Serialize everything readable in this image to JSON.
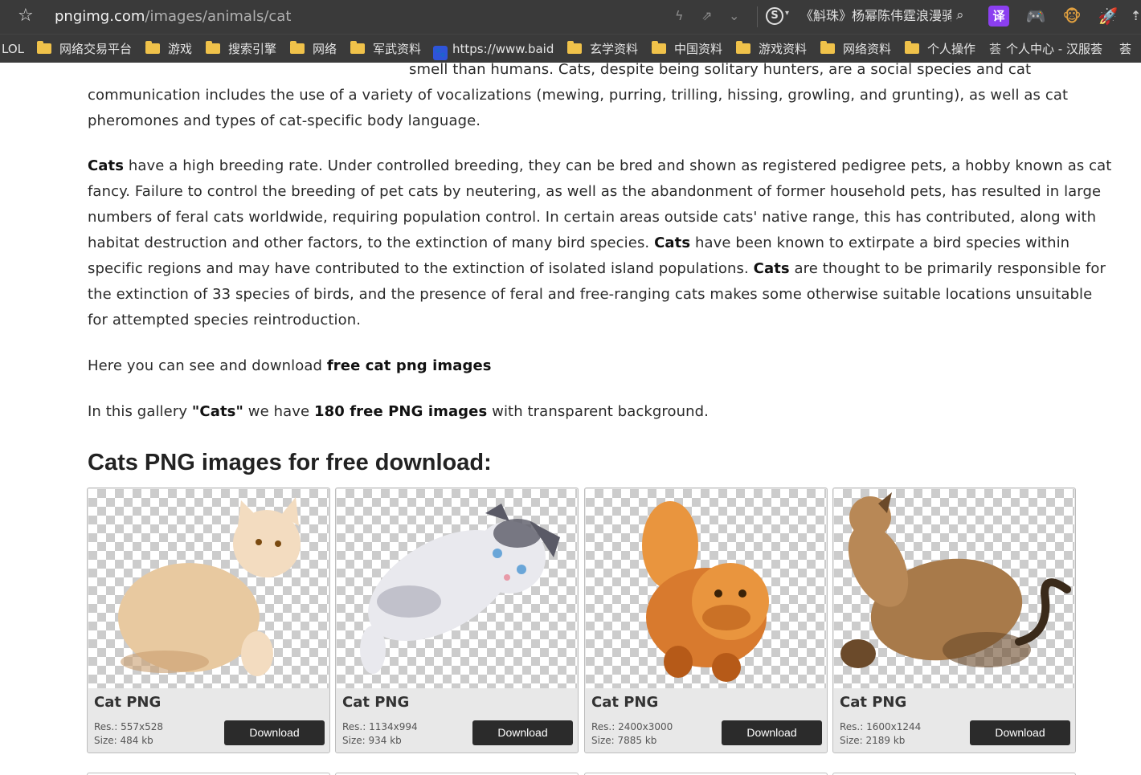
{
  "browser": {
    "url_host": "pngimg.com",
    "url_path": "/images/animals/cat",
    "news_ticker": "《斛珠》杨幂陈伟霆浪漫骑",
    "translate_label": "译"
  },
  "bookmarks": [
    {
      "label": "LOL",
      "icon": "none"
    },
    {
      "label": "网络交易平台",
      "icon": "folder-icon"
    },
    {
      "label": "游戏",
      "icon": "folder-icon"
    },
    {
      "label": "搜索引擎",
      "icon": "folder-icon"
    },
    {
      "label": "网络",
      "icon": "folder-icon"
    },
    {
      "label": "军武资料",
      "icon": "folder-icon"
    },
    {
      "label": "https://www.baid",
      "icon": "baidu-paw-icon"
    },
    {
      "label": "玄学资料",
      "icon": "folder-icon"
    },
    {
      "label": "中国资料",
      "icon": "folder-icon"
    },
    {
      "label": "游戏资料",
      "icon": "folder-icon"
    },
    {
      "label": "网络资料",
      "icon": "folder-icon"
    },
    {
      "label": "个人操作",
      "icon": "folder-icon"
    },
    {
      "label": "个人中心 - 汉服荟",
      "icon": "site-icon"
    },
    {
      "label": "荟",
      "icon": "site-icon"
    }
  ],
  "article": {
    "p1": [
      "smell than humans. Cats, despite being solitary hunters, are a social species and cat",
      "communication includes the use of a variety of vocalizations (mewing, purring, trilling, hissing, growling, and grunting), as well as cat",
      "pheromones and types of cat-specific body language."
    ],
    "p2": {
      "l1_bold": "Cats",
      "l1": " have a high breeding rate. Under controlled breeding, they can be bred and shown as registered pedigree pets, a hobby known as cat",
      "l2": "fancy. Failure to control the breeding of pet cats by neutering, as well as the abandonment of former household pets, has resulted in large",
      "l3": "numbers of feral cats worldwide, requiring population control. In certain areas outside cats' native range, this has contributed, along with",
      "l4a": "habitat destruction and other factors, to the extinction of many bird species. ",
      "l4_bold": "Cats",
      "l4b": " have been known to extirpate a bird species within",
      "l5a": "specific regions and may have contributed to the extinction of isolated island populations. ",
      "l5_bold": "Cats",
      "l5b": " are thought to be primarily responsible for",
      "l6": "the extinction of 33 species of birds, and the presence of feral and free-ranging cats makes some otherwise suitable locations unsuitable",
      "l7": "for attempted species reintroduction."
    },
    "p3": {
      "text": "Here you can see and download ",
      "bold": "free cat png images"
    },
    "p4": {
      "a": "In this gallery ",
      "bold1": "\"Cats\"",
      "b": " we have ",
      "bold2": "180 free PNG images",
      "c": " with transparent background."
    }
  },
  "gallery": {
    "title": "Cats PNG images for free download:",
    "download_label": "Download",
    "cards": [
      {
        "title": "Cat PNG",
        "res": "Res.: 557x528",
        "size": "Size: 484 kb",
        "colors": {
          "body": "#e8c9a0",
          "shade": "#c99f70",
          "face": "#f3dcc0"
        }
      },
      {
        "title": "Cat PNG",
        "res": "Res.: 1134x994",
        "size": "Size: 934 kb",
        "colors": {
          "body": "#e9e9ee",
          "shade": "#9a9aa8",
          "face": "#5a5a66"
        }
      },
      {
        "title": "Cat PNG",
        "res": "Res.: 2400x3000",
        "size": "Size: 7885 kb",
        "colors": {
          "body": "#d87a2e",
          "shade": "#b65a18",
          "face": "#e9953e"
        }
      },
      {
        "title": "Cat PNG",
        "res": "Res.: 1600x1244",
        "size": "Size: 2189 kb",
        "colors": {
          "body": "#a87a4a",
          "shade": "#6b4a2a",
          "face": "#b88856"
        }
      }
    ]
  }
}
